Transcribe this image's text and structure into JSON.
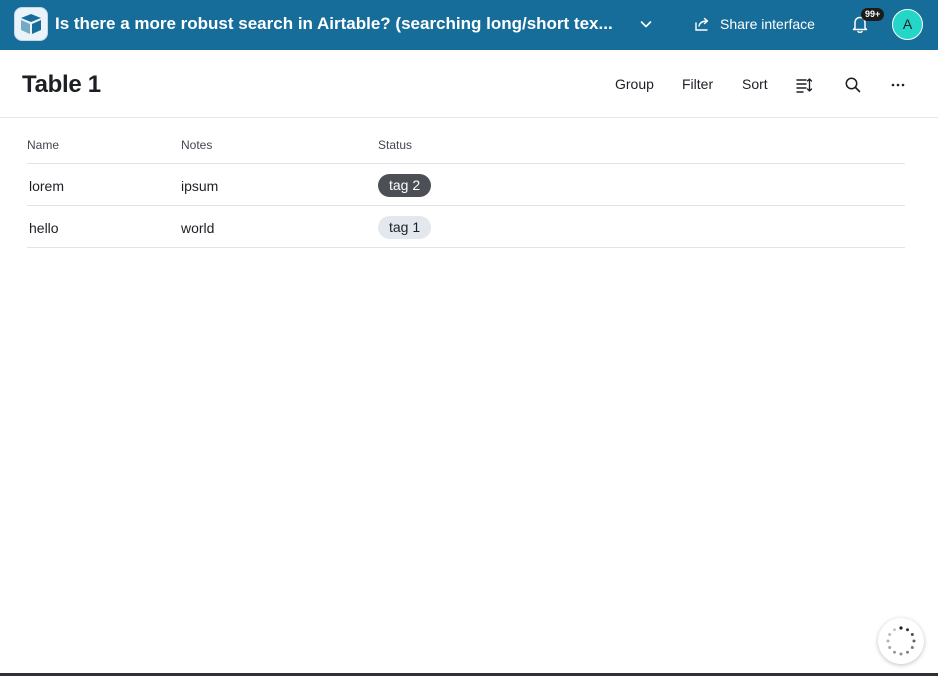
{
  "topbar": {
    "title": "Is there a more robust search in Airtable? (searching long/short tex...",
    "share_label": "Share interface",
    "notification_count": "99+",
    "avatar_initial": "A",
    "background_color": "#166d9a"
  },
  "header": {
    "title": "Table 1",
    "group_label": "Group",
    "filter_label": "Filter",
    "sort_label": "Sort",
    "icons": [
      "row-height-icon",
      "search-icon",
      "more-icon"
    ]
  },
  "table": {
    "columns": [
      "Name",
      "Notes",
      "Status"
    ],
    "rows": [
      {
        "name": "lorem",
        "notes": "ipsum",
        "status": "tag 2",
        "status_color": "#4c4f55"
      },
      {
        "name": "hello",
        "notes": "world",
        "status": "tag 1",
        "status_color": "#e3e8ef"
      }
    ]
  },
  "loader": {
    "icon": "loading-spinner-icon"
  }
}
